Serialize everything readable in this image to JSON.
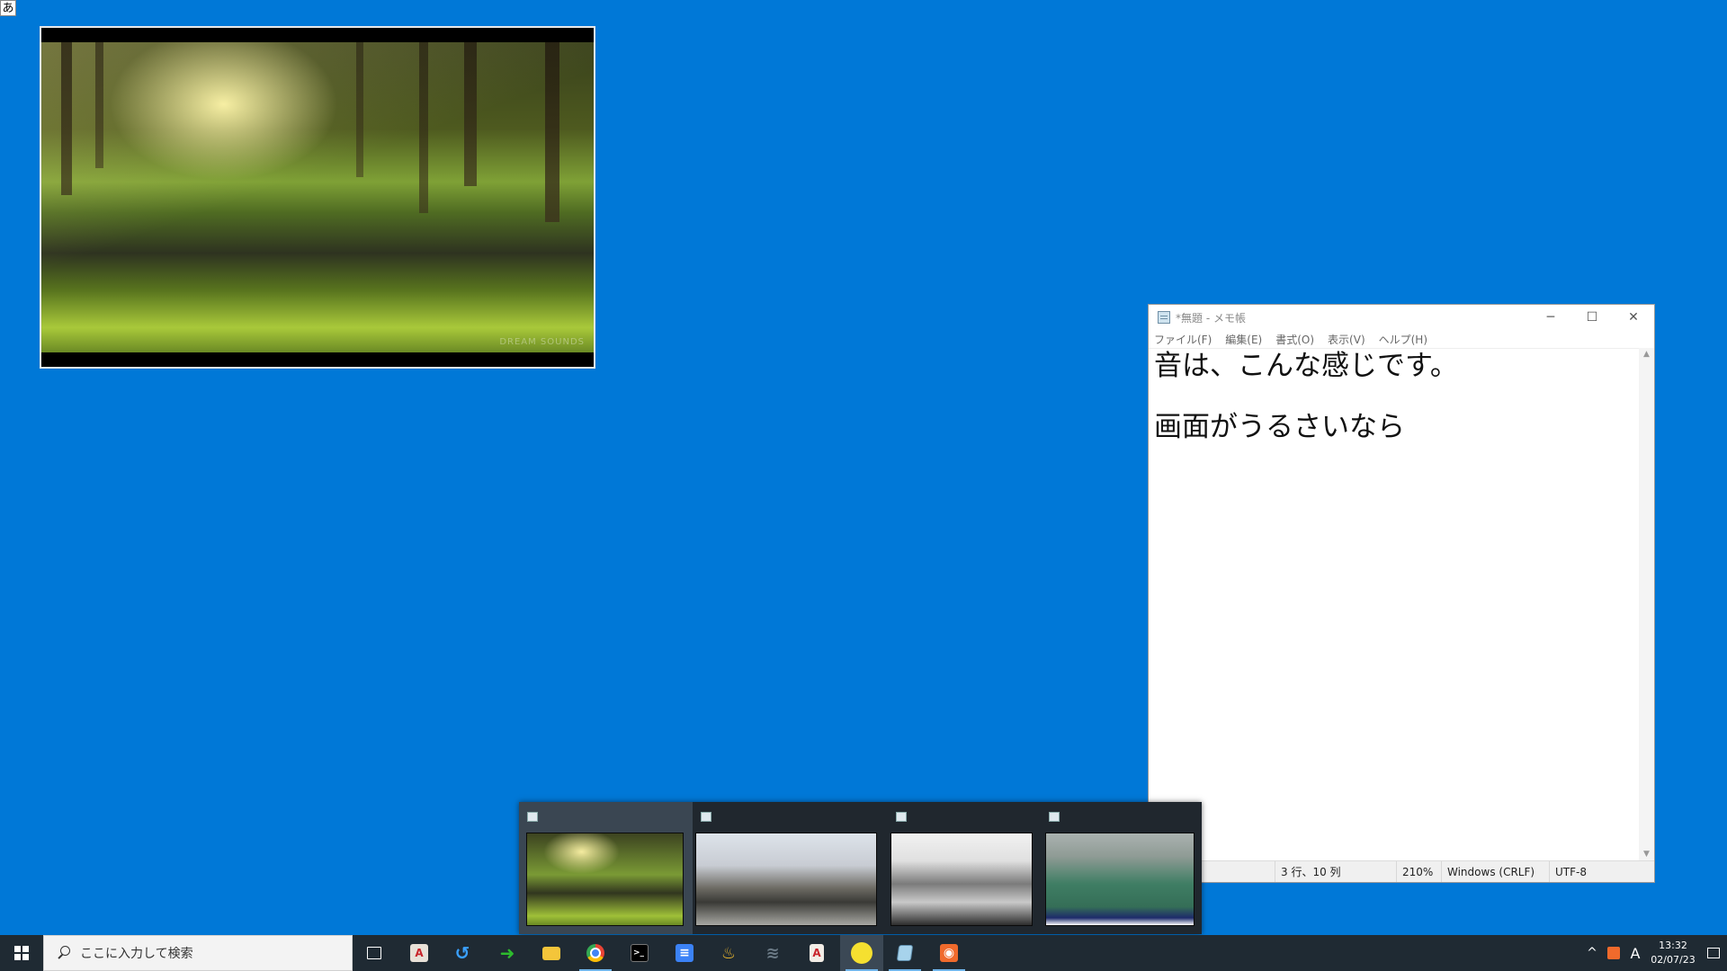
{
  "ime_indicator": "あ",
  "video_window": {
    "watermark": "DREAM SOUNDS"
  },
  "notepad": {
    "title": "*無題 - メモ帳",
    "controls": {
      "minimize": "─",
      "maximize": "☐",
      "close": "✕"
    },
    "menu": [
      "ファイル(F)",
      "編集(E)",
      "書式(O)",
      "表示(V)",
      "ヘルプ(H)"
    ],
    "lines": [
      "音は、こんな感じです。",
      "画面がうるさいなら"
    ],
    "status": {
      "position": "3 行、10 列",
      "zoom": "210%",
      "line_ending": "Windows (CRLF)",
      "encoding": "UTF-8"
    }
  },
  "thumbnail_popup": {
    "thumbnails": [
      {
        "content": "forest-stream",
        "active": true
      },
      {
        "content": "cherry-blossom-road",
        "active": false
      },
      {
        "content": "electone-performance",
        "active": false
      },
      {
        "content": "tennis-court-broadcast",
        "active": false
      }
    ]
  },
  "taskbar": {
    "search_placeholder": "ここに入力して検索",
    "pinned": [
      {
        "name": "task-view-icon",
        "glyph": "▣",
        "color": "#ffffff"
      },
      {
        "name": "adobe-icon",
        "glyph": "A",
        "color": "#e8e1d8"
      },
      {
        "name": "refresh-arrow-icon",
        "glyph": "↺",
        "color": "#3aa0ff"
      },
      {
        "name": "green-arrow-icon",
        "glyph": "➜",
        "color": "#2dbb2d"
      },
      {
        "name": "file-explorer-icon",
        "glyph": "▬",
        "color": "#f4c53a"
      },
      {
        "name": "chrome-icon",
        "glyph": "●",
        "color": "#e94335"
      },
      {
        "name": "terminal-icon",
        "glyph": ">_",
        "color": "#000000"
      },
      {
        "name": "docs-icon",
        "glyph": "≡",
        "color": "#3b82f6"
      },
      {
        "name": "pot-icon",
        "glyph": "♨",
        "color": "#e9b52e"
      },
      {
        "name": "cloud-tool-icon",
        "glyph": "≋",
        "color": "#6b7a86"
      },
      {
        "name": "pdf-icon",
        "glyph": "A",
        "color": "#f2ede6"
      },
      {
        "name": "sticky-app-icon",
        "glyph": "■",
        "color": "#f5e030"
      },
      {
        "name": "notepad-icon",
        "glyph": "▤",
        "color": "#a7d3ec"
      },
      {
        "name": "orange-app-icon",
        "glyph": "◉",
        "color": "#f06a2c"
      }
    ],
    "tray": {
      "chevron": "^",
      "ime_mode": "A",
      "time": "13:32",
      "date": "02/07/23"
    }
  }
}
